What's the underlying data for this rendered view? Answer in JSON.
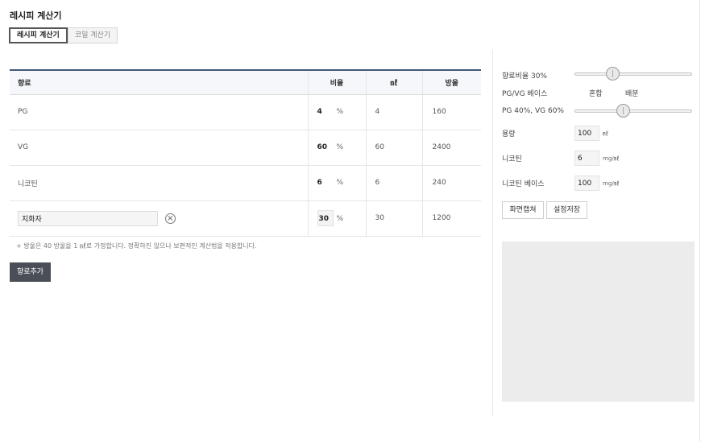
{
  "page": {
    "title": "레시피 계산기"
  },
  "tabs": [
    {
      "label": "레시피 계산기",
      "active": true
    },
    {
      "label": "코일 계산기",
      "active": false
    }
  ],
  "table": {
    "headers": {
      "name": "향료",
      "ratio": "비율",
      "ml": "㎖",
      "drops": "방울"
    },
    "rows": [
      {
        "name": "PG",
        "ratio": "4",
        "pct": "%",
        "ml": "4",
        "drops": "160"
      },
      {
        "name": "VG",
        "ratio": "60",
        "pct": "%",
        "ml": "60",
        "drops": "2400"
      },
      {
        "name": "니코틴",
        "ratio": "6",
        "pct": "%",
        "ml": "6",
        "drops": "240"
      },
      {
        "name": "지화자",
        "ratio": "30",
        "pct": "%",
        "ml": "30",
        "drops": "1200",
        "editable": true
      }
    ]
  },
  "footnote": "+ 방울은 40 방울을 1 ㎖로 가정합니다. 정확하진 않으나 보편적인 계산법을 적용합니다.",
  "add_button": "향료추가",
  "settings": {
    "flavor_ratio_label": "향료비율 30%",
    "flavor_ratio_value": 30,
    "pgvg_base_label": "PG/VG 베이스",
    "pgvg_options": [
      "혼합",
      "배분"
    ],
    "pgvg_ratio_label": "PG 40%, VG 60%",
    "pgvg_ratio_value": 40,
    "volume_label": "용량",
    "volume_value": "100",
    "volume_unit": "㎖",
    "nicotine_label": "니코틴",
    "nicotine_value": "6",
    "nicotine_unit": "mg/㎖",
    "nicotine_base_label": "니코틴 베이스",
    "nicotine_base_value": "100",
    "nicotine_base_unit": "mg/㎖",
    "capture_button": "화면캡쳐",
    "save_button": "설정저장"
  },
  "icons": {
    "remove": "close-circle-icon"
  },
  "colors": {
    "table_header_border": "#3d5a7a",
    "add_button_bg": "#4a4f57"
  }
}
